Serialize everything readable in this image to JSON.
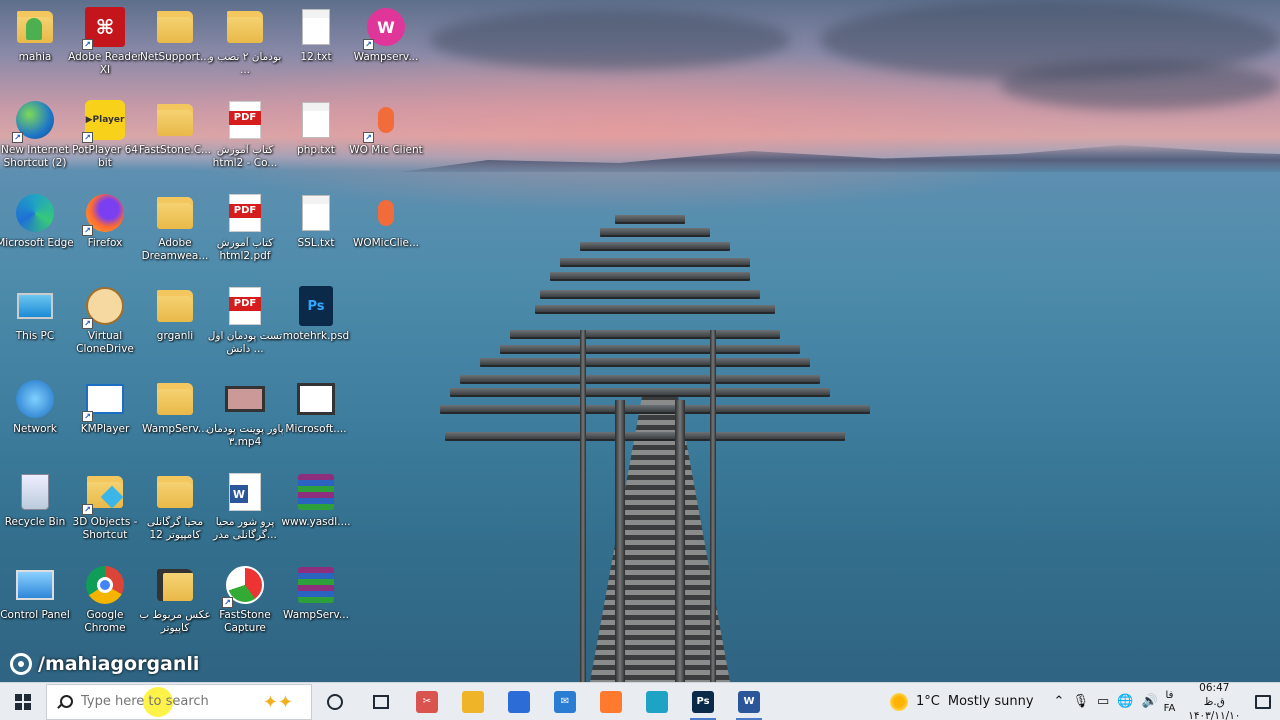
{
  "desktop": {
    "icons": [
      {
        "label": "mahia",
        "kind": "folder-user",
        "shortcut": false
      },
      {
        "label": "Adobe Reader XI",
        "kind": "adobe",
        "shortcut": true
      },
      {
        "label": "NetSupport...",
        "kind": "folder",
        "shortcut": false
      },
      {
        "label": "بودمان ۲ نصب و ...",
        "kind": "folder",
        "shortcut": false
      },
      {
        "label": "12.txt",
        "kind": "doc",
        "shortcut": false
      },
      {
        "label": "Wampserv...",
        "kind": "wamp",
        "shortcut": true
      },
      {
        "label": "New Internet Shortcut (2)",
        "kind": "globe",
        "shortcut": true
      },
      {
        "label": "PotPlayer 64 bit",
        "kind": "potplayer",
        "shortcut": true
      },
      {
        "label": "FastStone.C...",
        "kind": "folder",
        "shortcut": false
      },
      {
        "label": "کتاب آموزش html2 - Co...",
        "kind": "pdf",
        "shortcut": false
      },
      {
        "label": "php.txt",
        "kind": "doc",
        "shortcut": false
      },
      {
        "label": "WO Mic Client",
        "kind": "mic",
        "shortcut": true
      },
      {
        "label": "Microsoft Edge",
        "kind": "edge",
        "shortcut": false
      },
      {
        "label": "Firefox",
        "kind": "firefox",
        "shortcut": true
      },
      {
        "label": "Adobe Dreamwea...",
        "kind": "folder",
        "shortcut": false
      },
      {
        "label": "کتاب آموزش html2.pdf",
        "kind": "pdf",
        "shortcut": false
      },
      {
        "label": "SSL.txt",
        "kind": "doc",
        "shortcut": false
      },
      {
        "label": "WOMicClie...",
        "kind": "mic",
        "shortcut": false
      },
      {
        "label": "This PC",
        "kind": "pc",
        "shortcut": false
      },
      {
        "label": "Virtual CloneDrive",
        "kind": "clone",
        "shortcut": true
      },
      {
        "label": "grganli",
        "kind": "folder",
        "shortcut": false
      },
      {
        "label": "تست پودمان اول دانش ...",
        "kind": "pdf",
        "shortcut": false
      },
      {
        "label": "motehrk.psd",
        "kind": "psd",
        "shortcut": false
      },
      {
        "label": "",
        "kind": "none",
        "shortcut": false
      },
      {
        "label": "Network",
        "kind": "network",
        "shortcut": false
      },
      {
        "label": "KMPlayer",
        "kind": "kmplayer",
        "shortcut": true
      },
      {
        "label": "WampServ...",
        "kind": "folder",
        "shortcut": false
      },
      {
        "label": "پاور پوینت پودمان ۳.mp4",
        "kind": "video",
        "shortcut": false
      },
      {
        "label": "Microsoft....",
        "kind": "rdp",
        "shortcut": false
      },
      {
        "label": "",
        "kind": "none",
        "shortcut": false
      },
      {
        "label": "Recycle Bin",
        "kind": "bin",
        "shortcut": false
      },
      {
        "label": "3D Objects - Shortcut",
        "kind": "folder3d",
        "shortcut": true
      },
      {
        "label": "محیا گرگانلی کامپیوتر 12",
        "kind": "folder",
        "shortcut": false
      },
      {
        "label": "پرو شور محیا گرگانلی مدر...",
        "kind": "word",
        "shortcut": false
      },
      {
        "label": "www.yasdl....",
        "kind": "rar",
        "shortcut": false
      },
      {
        "label": "",
        "kind": "none",
        "shortcut": false
      },
      {
        "label": "Control Panel",
        "kind": "control",
        "shortcut": false
      },
      {
        "label": "Google Chrome",
        "kind": "chrome",
        "shortcut": false
      },
      {
        "label": "عکس مربوط ب کاپیوتر",
        "kind": "folder-dark",
        "shortcut": false
      },
      {
        "label": "FastStone Capture",
        "kind": "faststone",
        "shortcut": true
      },
      {
        "label": "WampServ...",
        "kind": "rar",
        "shortcut": false
      },
      {
        "label": "",
        "kind": "none",
        "shortcut": false
      }
    ],
    "watermark": "/mahiagorganli"
  },
  "taskbar": {
    "search_placeholder": "Type here to search",
    "pinned": [
      {
        "name": "snipping-tool",
        "label": "✂",
        "color": "#d9534f",
        "active": false
      },
      {
        "name": "file-explorer",
        "label": "",
        "color": "#f0b429",
        "active": false
      },
      {
        "name": "microsoft-store",
        "label": "",
        "color": "#2b6cd6",
        "active": false
      },
      {
        "name": "mail",
        "label": "✉",
        "color": "#2b7cd3",
        "active": false
      },
      {
        "name": "firefox",
        "label": "",
        "color": "#ff7a2f",
        "active": false
      },
      {
        "name": "edge",
        "label": "",
        "color": "#1fa3c4",
        "active": false
      },
      {
        "name": "photoshop",
        "label": "Ps",
        "color": "#0b2a4a",
        "active": true
      },
      {
        "name": "word",
        "label": "W",
        "color": "#2b579a",
        "active": true
      }
    ],
    "weather": {
      "temp": "1°C",
      "condition": "Mostly sunny"
    },
    "language": {
      "top": "فا",
      "bottom": "FA"
    },
    "clock": {
      "time": "06:47 ق.ظ",
      "date": "۱۴۰۳/۱۱/۱۰"
    }
  }
}
